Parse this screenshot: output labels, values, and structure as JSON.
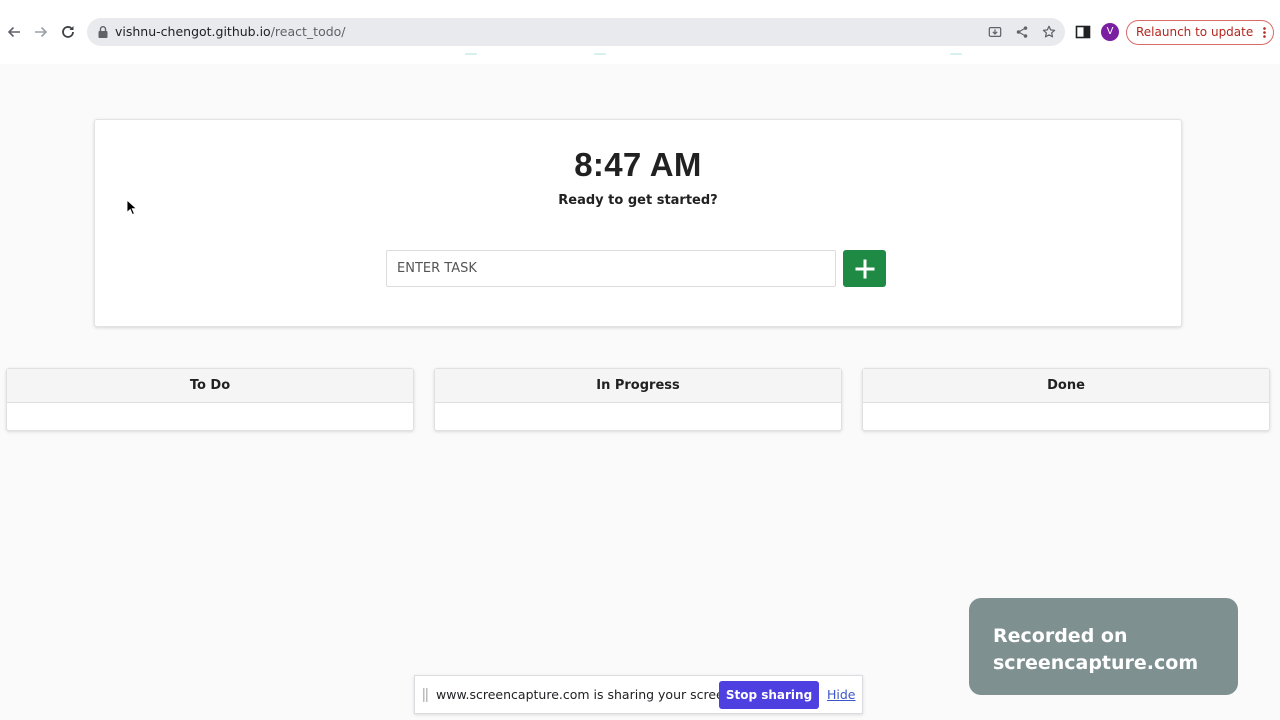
{
  "browser": {
    "url_host": "vishnu-chengot.github.io",
    "url_path": "/react_todo/",
    "profile_initial": "V",
    "relaunch_label": "Relaunch to update",
    "icons": [
      "back-icon",
      "forward-icon",
      "reload-icon",
      "lock-icon",
      "install-icon",
      "share-icon",
      "star-icon",
      "side-panel-icon",
      "more-icon"
    ]
  },
  "app": {
    "time": "8:47 AM",
    "greeting": "Ready to get started?",
    "task_placeholder": "ENTER TASK",
    "add_icon": "plus-icon",
    "accent_color": "#1e8a43",
    "columns": [
      {
        "title": "To Do"
      },
      {
        "title": "In Progress"
      },
      {
        "title": "Done"
      }
    ]
  },
  "watermark": {
    "line1": "Recorded on",
    "line2": "screencapture.com"
  },
  "share_bar": {
    "message": "www.screencapture.com is sharing your screen.",
    "stop_label": "Stop sharing",
    "hide_label": "Hide",
    "stop_color": "#4e3fe0"
  }
}
